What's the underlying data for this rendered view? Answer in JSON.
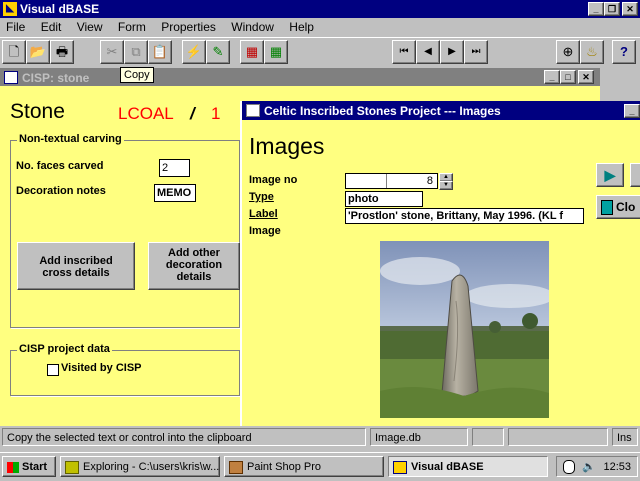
{
  "app": {
    "title": "Visual dBASE"
  },
  "menu": [
    "File",
    "Edit",
    "View",
    "Form",
    "Properties",
    "Window",
    "Help"
  ],
  "tooltip": "Copy",
  "cisp_window": {
    "title": "CISP: stone",
    "heading": "Stone",
    "code": "LCOAL",
    "separator": "/",
    "number": "1",
    "carving_group": "Non-textual carving",
    "faces_label": "No. faces carved",
    "faces_value": "2",
    "decoration_label": "Decoration notes",
    "decoration_value": "MEMO",
    "add_cross_button": "Add inscribed cross details",
    "add_decoration_button": "Add other decoration details",
    "project_group": "CISP project data",
    "visited_label": "Visited by CISP",
    "visited_checked": false
  },
  "images_window": {
    "title": "Celtic Inscribed Stones Project --- Images",
    "heading": "Images",
    "image_no_label": "Image no",
    "image_no_value": "8",
    "type_label": "Type",
    "type_value": "photo",
    "label_label": "Label",
    "label_value": "'Prostlon' stone, Brittany, May 1996. (KL f",
    "image_label": "Image",
    "close_button": "Clo"
  },
  "statusbar": {
    "message": "Copy the selected text or control into the clipboard",
    "table": "Image.db",
    "mode": "Ins"
  },
  "taskbar": {
    "start": "Start",
    "items": [
      "Exploring - C:\\users\\kris\\w...",
      "Paint Shop Pro",
      "Visual dBASE"
    ],
    "time": "12:53"
  },
  "colors": {
    "form_bg": "#ffff80",
    "title_active": "#000080",
    "code_red": "#ff0000"
  }
}
